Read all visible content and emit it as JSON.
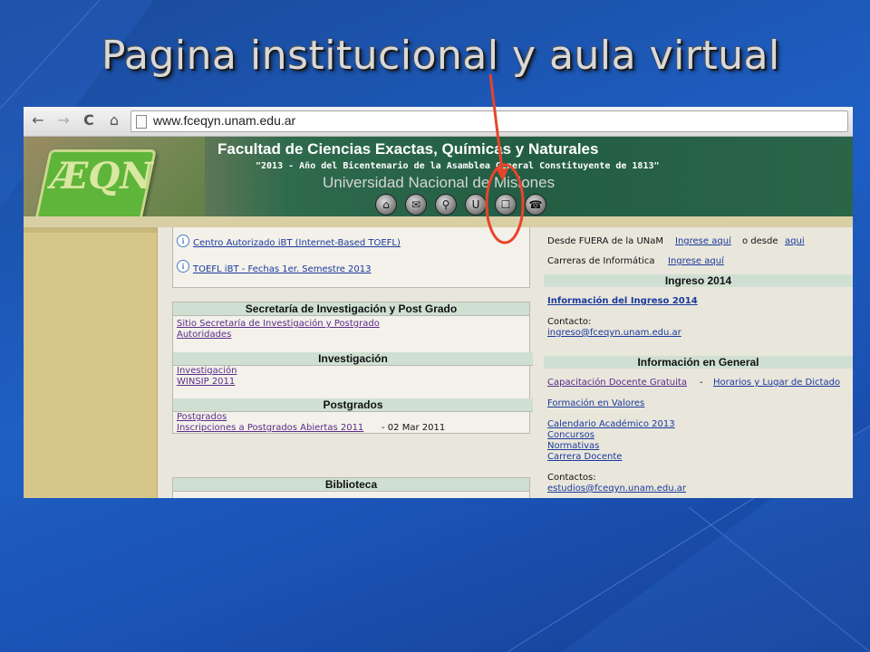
{
  "slide": {
    "title": "Pagina institucional y aula virtual"
  },
  "browser": {
    "back_icon": "←",
    "forward_icon": "→",
    "reload_icon": "C",
    "home_icon": "⌂",
    "url": "www.fceqyn.unam.edu.ar"
  },
  "header": {
    "logo_text": "ÆQN",
    "title": "Facultad de Ciencias Exactas, Químicas y Naturales",
    "subtitle": "\"2013 - Año del Bicentenario de la Asamblea General Constituyente de 1813\"",
    "university": "Universidad Nacional de Misiones",
    "nav_icons": [
      "⌂",
      "✉",
      "⚲",
      "U",
      "☐",
      "☎"
    ]
  },
  "left_col": {
    "toefl_links": [
      "Centro Autorizado iBT (Internet-Based TOEFL)",
      "TOEFL iBT - Fechas 1er. Semestre 2013"
    ],
    "secretaria": {
      "title": "Secretaría de Investigación y Post Grado",
      "links": [
        "Sitio Secretaría de Investigación y Postgrado",
        "Autoridades"
      ]
    },
    "investigacion": {
      "title": "Investigación",
      "links": [
        "Investigación",
        "WINSIP 2011"
      ]
    },
    "postgrados": {
      "title": "Postgrados",
      "links": [
        "Postgrados",
        "Inscripciones a Postgrados Abiertas 2011"
      ],
      "date": "- 02 Mar 2011"
    },
    "biblioteca": {
      "title": "Biblioteca"
    }
  },
  "right_col": {
    "desde_fuera": "Desde FUERA de la UNaM",
    "ingrese_aqui": "Ingrese aquí",
    "o_desde": "o desde",
    "aqui": "aqui",
    "carreras": "Carreras de Informática",
    "ingrese_aqui2": "Ingrese aquí",
    "ingreso_title": "Ingreso 2014",
    "ingreso_link": "Información del Ingreso 2014",
    "contacto": "Contacto:",
    "ingreso_email": "ingreso@fceqyn.unam.edu.ar",
    "info_general": "Información en General",
    "capacitacion": "Capacitación Docente Gratuita",
    "dash": "-",
    "horarios": "Horarios y Lugar de Dictado",
    "formacion": "Formación en Valores",
    "calendario": "Calendario Académico 2013",
    "concursos": "Concursos",
    "normativas": "Normativas",
    "carrera_docente": "Carrera Docente",
    "contactos": "Contactos:",
    "estudios_email": "estudios@fceqyn.unam.edu.ar"
  },
  "colors": {
    "annotation": "#e8442a",
    "header_green": "#235e44",
    "link": "#1a3a9c"
  }
}
